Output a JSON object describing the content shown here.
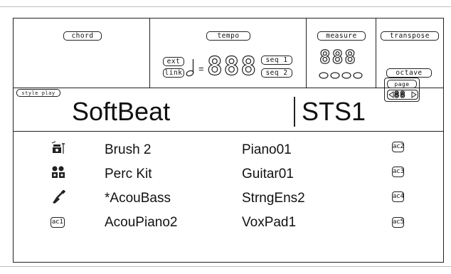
{
  "display": {
    "chord": {
      "label": "chord"
    },
    "tempo": {
      "label": "tempo",
      "ext": "ext",
      "link": "link",
      "seq1": "seq 1",
      "seq2": "seq 2",
      "digits": "888"
    },
    "measure": {
      "label": "measure",
      "digits": "888"
    },
    "transpose": {
      "label": "transpose",
      "octave": "octave"
    },
    "style_play": {
      "badge": "style play",
      "name": "SoftBeat",
      "code": "STS1"
    },
    "page": {
      "label": "page",
      "digits": "88"
    }
  },
  "tracks": [
    {
      "icon": "drum-kit-icon",
      "lower": "Brush 2",
      "upper": "Piano01",
      "ac": "ac2"
    },
    {
      "icon": "percussion-icon",
      "lower": "Perc Kit",
      "upper": "Guitar01",
      "ac": "ac3"
    },
    {
      "icon": "bass-guitar-icon",
      "lower": "*AcouBass",
      "upper": "StrngEns2",
      "ac": "ac4"
    },
    {
      "icon": "ac1-badge",
      "lower": "AcouPiano2",
      "upper": "VoxPad1",
      "ac": "ac5",
      "left_badge": "ac1"
    }
  ]
}
